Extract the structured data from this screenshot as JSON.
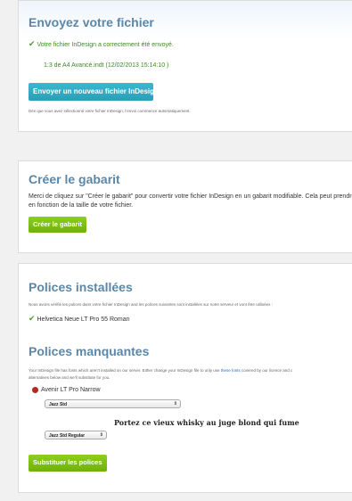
{
  "upload": {
    "title": "Envoyez votre fichier",
    "success_msg": "Votre fichier InDesign a correctement été envoyé.",
    "file_info": "1:3 de A4 Avancé.indt (12/02/2013 15:14:10 )",
    "button_label": "Envoyer un nouveau fichier InDesign",
    "note": "Dès que vous avez sélectionné votre fichier InDesign, l’envoi commence automatiquement."
  },
  "gabarit": {
    "title": "Créer le gabarit",
    "desc_line1": "Merci de cliquez sur \"Créer le gabarit\" pour convertir votre fichier InDesign en un gabarit modifiable. Cela peut prendre",
    "desc_line2": "en fonction de la taille de votre fichier.",
    "button_label": "Créer le gabarit"
  },
  "polices_installees": {
    "title": "Polices installées",
    "note": "Nous avons vérifié les polices dans votre fichier InDesign and les polices suivantes sont installées sur notre serveur et vont être utilisées :",
    "fonts": [
      "Helvetica Neue LT Pro 55 Roman"
    ]
  },
  "polices_manquantes": {
    "title": "Polices manquantes",
    "note_part1": "Your InDesign file has fonts which aren’t installed on our server. Either change your InDesign file to only use ",
    "note_link": "these fonts",
    "note_part2": " covered by our licence and c",
    "note_line2": "alternatives below and we'll substitute for you.",
    "missing_font": "Avenir LT Pro Narrow",
    "family_select": "Jazz Std",
    "style_select": "Jazz Std Regular",
    "preview_text": "Portez ce vieux whisky au juge blond qui fume",
    "button_label": "Substituer les polices"
  },
  "icons": {
    "check": "check-icon",
    "missing": "red-dot-icon",
    "select_arrow": "updown-arrow-icon"
  },
  "colors": {
    "heading": "#5b87a8",
    "success": "#3c8a1e",
    "blue_button": "#2fa8c0",
    "green_button": "#7cc012",
    "missing_dot": "#b7261f"
  }
}
